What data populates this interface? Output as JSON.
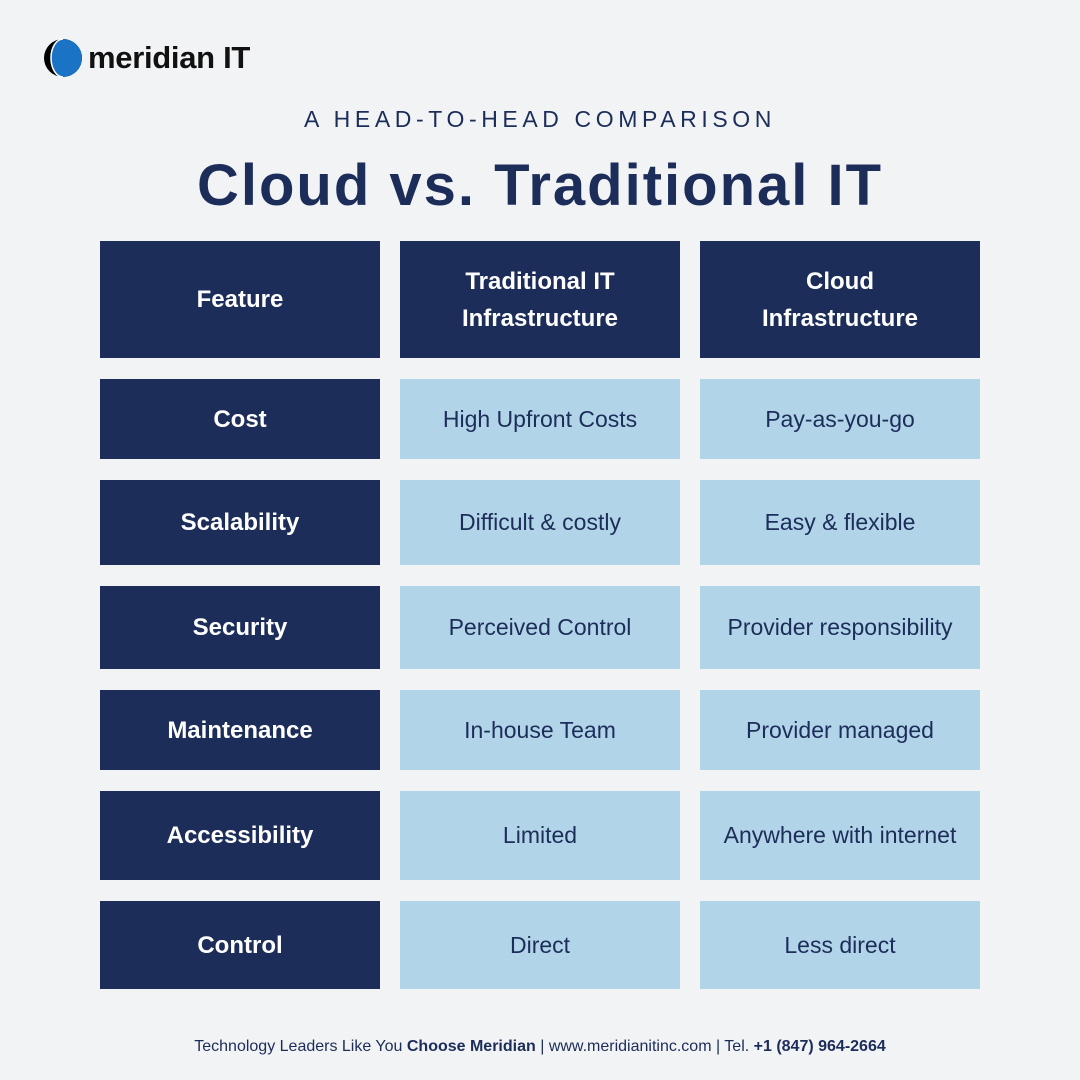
{
  "brand": {
    "name": "meridian IT",
    "logo_icon": "half-globe-icon",
    "colors": {
      "logo_blue": "#1a73c4",
      "logo_black": "#000000"
    }
  },
  "header": {
    "subtitle": "A HEAD-TO-HEAD COMPARISON",
    "title": "Cloud vs. Traditional IT"
  },
  "colors": {
    "background": "#f2f3f5",
    "navy": "#1c2d5a",
    "light_blue": "#b2d4e8",
    "white": "#ffffff"
  },
  "table": {
    "columns": [
      "Feature",
      "Traditional IT\nInfrastructure",
      "Cloud\nInfrastructure"
    ],
    "column_lines": [
      [
        "Feature"
      ],
      [
        "Traditional IT",
        "Infrastructure"
      ],
      [
        "Cloud",
        "Infrastructure"
      ]
    ],
    "rows": [
      {
        "feature": "Cost",
        "traditional": "High Upfront Costs",
        "cloud": "Pay-as-you-go"
      },
      {
        "feature": "Scalability",
        "traditional": "Difficult & costly",
        "cloud": "Easy & flexible"
      },
      {
        "feature": "Security",
        "traditional": "Perceived Control",
        "cloud": "Provider responsibility"
      },
      {
        "feature": "Maintenance",
        "traditional": "In-house Team",
        "cloud": "Provider managed"
      },
      {
        "feature": "Accessibility",
        "traditional": "Limited",
        "cloud": "Anywhere with internet"
      },
      {
        "feature": "Control",
        "traditional": "Direct",
        "cloud": "Less direct"
      }
    ]
  },
  "footer": {
    "tagline_prefix": "Technology Leaders Like You ",
    "tagline_bold": "Choose Meridian",
    "separator1": " | ",
    "website": "www.meridianitinc.com",
    "separator2": " | Tel. ",
    "phone": "+1 (847) 964-2664"
  }
}
